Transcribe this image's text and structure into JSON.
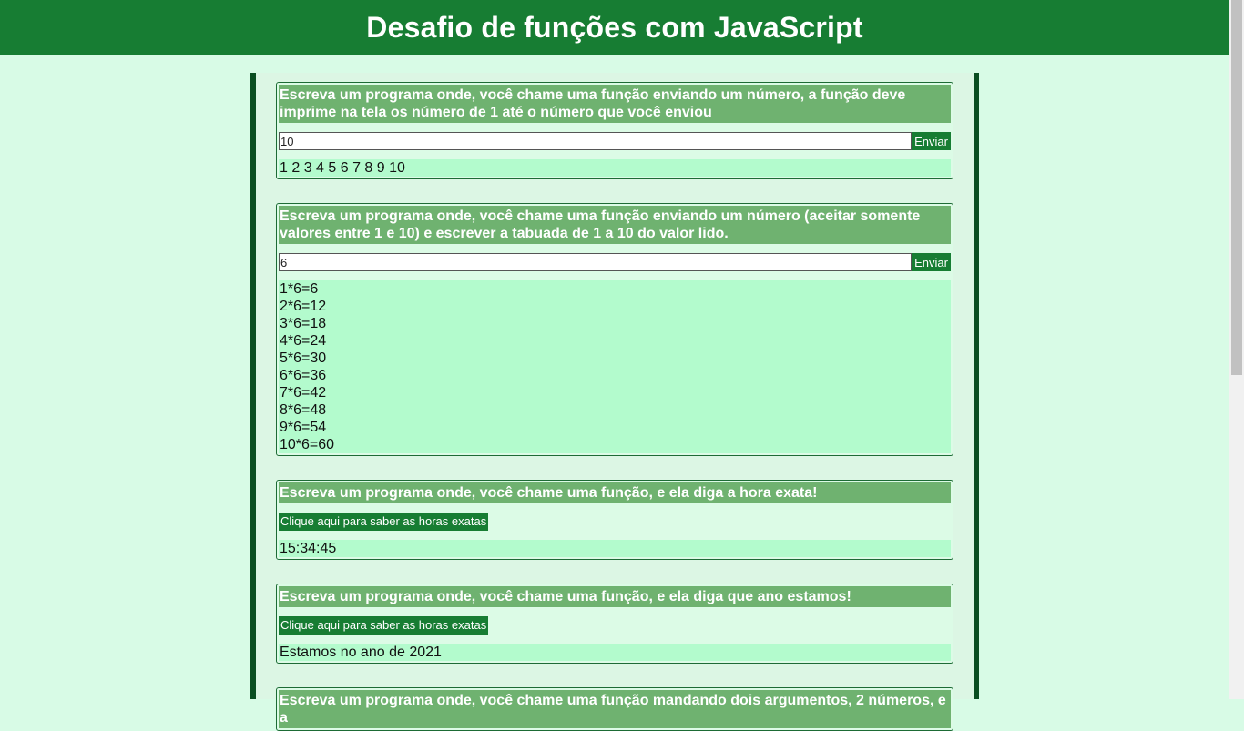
{
  "header": {
    "title": "Desafio de funções com JavaScript"
  },
  "cards": [
    {
      "title": "Escreva um programa onde, você chame uma função enviando um número, a função deve imprime na tela os número de 1 até o número que você enviou",
      "input_value": "10",
      "button_label": "Enviar",
      "output": "1 2 3 4 5 6 7 8 9 10"
    },
    {
      "title": "Escreva um programa onde, você chame uma função enviando um número (aceitar somente valores entre 1 e 10) e escrever a tabuada de 1 a 10 do valor lido.",
      "input_value": "6",
      "button_label": "Enviar",
      "output_lines": [
        "1*6=6",
        "2*6=12",
        "3*6=18",
        "4*6=24",
        "5*6=30",
        "6*6=36",
        "7*6=42",
        "8*6=48",
        "9*6=54",
        "10*6=60"
      ]
    },
    {
      "title": "Escreva um programa onde, você chame uma função, e ela diga a hora exata!",
      "button_label": "Clique aqui para saber as horas exatas",
      "output": "15:34:45"
    },
    {
      "title": "Escreva um programa onde, você chame uma função, e ela diga que ano estamos!",
      "button_label": "Clique aqui para saber as horas exatas",
      "output": "Estamos no ano de 2021"
    },
    {
      "title": "Escreva um programa onde, você chame uma função mandando dois argumentos, 2 números, e a"
    }
  ]
}
